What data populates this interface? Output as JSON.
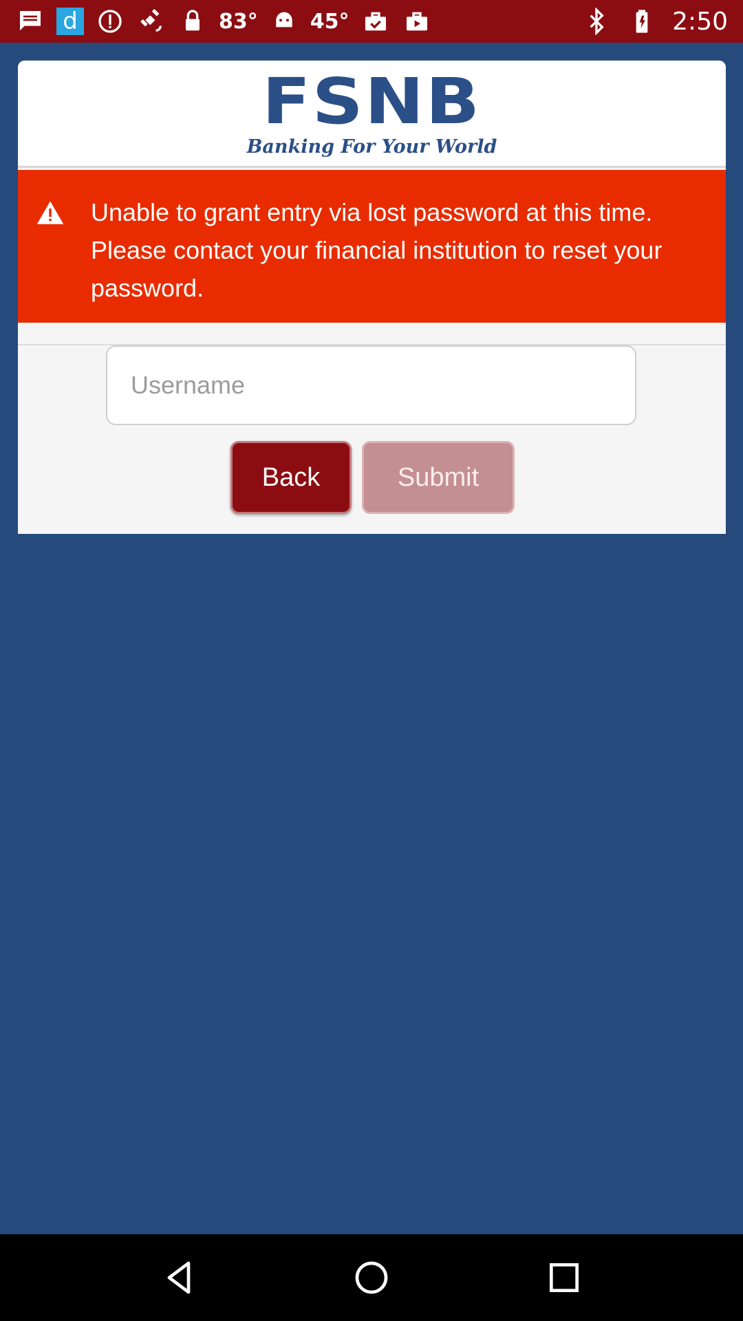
{
  "status_bar": {
    "icons": [
      "message-icon",
      "d-app-icon",
      "info-icon",
      "satellite-fake-gps-icon",
      "lock-icon"
    ],
    "temp1": "83°",
    "android_icon": "android-icon",
    "temp2": "45°",
    "right_icons": [
      "briefcase-check-icon",
      "briefcase-icon"
    ],
    "bluetooth": "bluetooth-icon",
    "battery": "battery-icon",
    "time": "2:50",
    "d_letter": "d"
  },
  "header": {
    "logo_text": "FSNB",
    "tagline": "Banking For Your World",
    "brand_color": "#2b4f87"
  },
  "alert": {
    "icon": "warning-icon",
    "message": "Unable to grant entry via lost password at this time. Please contact your financial institution to reset your password.",
    "color": "#e82c00"
  },
  "form": {
    "username_placeholder": "Username",
    "username_value": "",
    "back_label": "Back",
    "submit_label": "Submit"
  },
  "nav_bar": {
    "back": "back-triangle-icon",
    "home": "home-circle-icon",
    "recents": "recents-square-icon"
  }
}
